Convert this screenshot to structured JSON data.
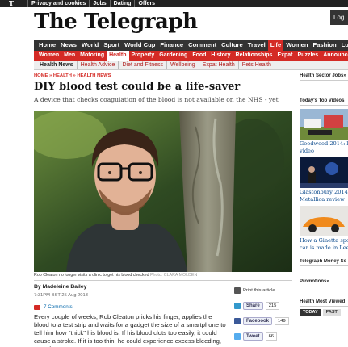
{
  "topbar": {
    "logo": "T",
    "links": [
      "Privacy and cookies",
      "Jobs",
      "Dating",
      "Offers"
    ],
    "login_label": "Log"
  },
  "masthead": {
    "title": "The Telegraph"
  },
  "nav_primary": [
    {
      "label": "Home",
      "active": false
    },
    {
      "label": "News",
      "active": false
    },
    {
      "label": "World",
      "active": false
    },
    {
      "label": "Sport",
      "active": false
    },
    {
      "label": "World Cup",
      "active": false
    },
    {
      "label": "Finance",
      "active": false
    },
    {
      "label": "Comment",
      "active": false
    },
    {
      "label": "Culture",
      "active": false
    },
    {
      "label": "Travel",
      "active": false
    },
    {
      "label": "Life",
      "active": true
    },
    {
      "label": "Women",
      "active": false
    },
    {
      "label": "Fashion",
      "active": false
    },
    {
      "label": "Luxury",
      "active": false
    }
  ],
  "nav_secondary": [
    {
      "label": "Women",
      "active": false
    },
    {
      "label": "Men",
      "active": false
    },
    {
      "label": "Motoring",
      "active": false
    },
    {
      "label": "Health",
      "active": true
    },
    {
      "label": "Property",
      "active": false
    },
    {
      "label": "Gardening",
      "active": false
    },
    {
      "label": "Food",
      "active": false
    },
    {
      "label": "History",
      "active": false
    },
    {
      "label": "Relationships",
      "active": false
    },
    {
      "label": "Expat",
      "active": false
    },
    {
      "label": "Puzzles",
      "active": false
    },
    {
      "label": "Announce",
      "active": false
    }
  ],
  "nav_tertiary": [
    {
      "label": "Health News",
      "active": true
    },
    {
      "label": "Health Advice",
      "active": false
    },
    {
      "label": "Diet and Fitness",
      "active": false
    },
    {
      "label": "Wellbeing",
      "active": false
    },
    {
      "label": "Expat Health",
      "active": false
    },
    {
      "label": "Pets Health",
      "active": false
    }
  ],
  "breadcrumb": "HOME » HEALTH » HEALTH NEWS",
  "article": {
    "title": "DIY blood test could be a life-saver",
    "standfirst": "A device that checks coagulation of the blood is not available on the NHS - yet",
    "caption": "Rob Cleaton no longer visits a clinic to get his blood checked",
    "credit": "Photo: CLARA MOLDEN",
    "byline": "By Madeleine Bailey",
    "date": "7:31PM BST 25 Aug 2013",
    "comments": "7 Comments",
    "body": "Every couple of weeks, Rob Cleaton pricks his finger, applies the blood to a test strip and waits for a gadget the size of a smartphone to tell him how \"thick\" his blood is. If his blood clots too easily, it could cause a stroke. If it is too thin, he could experience excess bleeding, even from a"
  },
  "share": {
    "print_label": "Print this article",
    "buttons": [
      {
        "label": "Share",
        "count": "215",
        "icon": "twitter-icon"
      },
      {
        "label": "Facebook",
        "count": "149",
        "icon": "facebook-icon"
      },
      {
        "label": "Tweet",
        "count": "66",
        "icon": "tweet-icon"
      }
    ]
  },
  "sidebar": {
    "jobs_heading": "Health Sector Jobs»",
    "videos_heading": "Today's Top Videos",
    "videos": [
      {
        "title": "Goodwood 2014: liv",
        "subtitle": "video"
      },
      {
        "title": "Glastonbury 2014 -",
        "subtitle": "Metallica review"
      },
      {
        "title": "How a Ginetta sport",
        "subtitle": "car is made in Leeds"
      }
    ],
    "money_heading": "Telegraph Money Se",
    "promotions_heading": "Promotions»",
    "most_viewed_heading": "Health Most Viewed",
    "tabs": [
      "TODAY",
      "PAST"
    ]
  },
  "colors": {
    "brand_red": "#d42a25",
    "nav_dark": "#333333",
    "link_blue": "#0b4a8c"
  }
}
